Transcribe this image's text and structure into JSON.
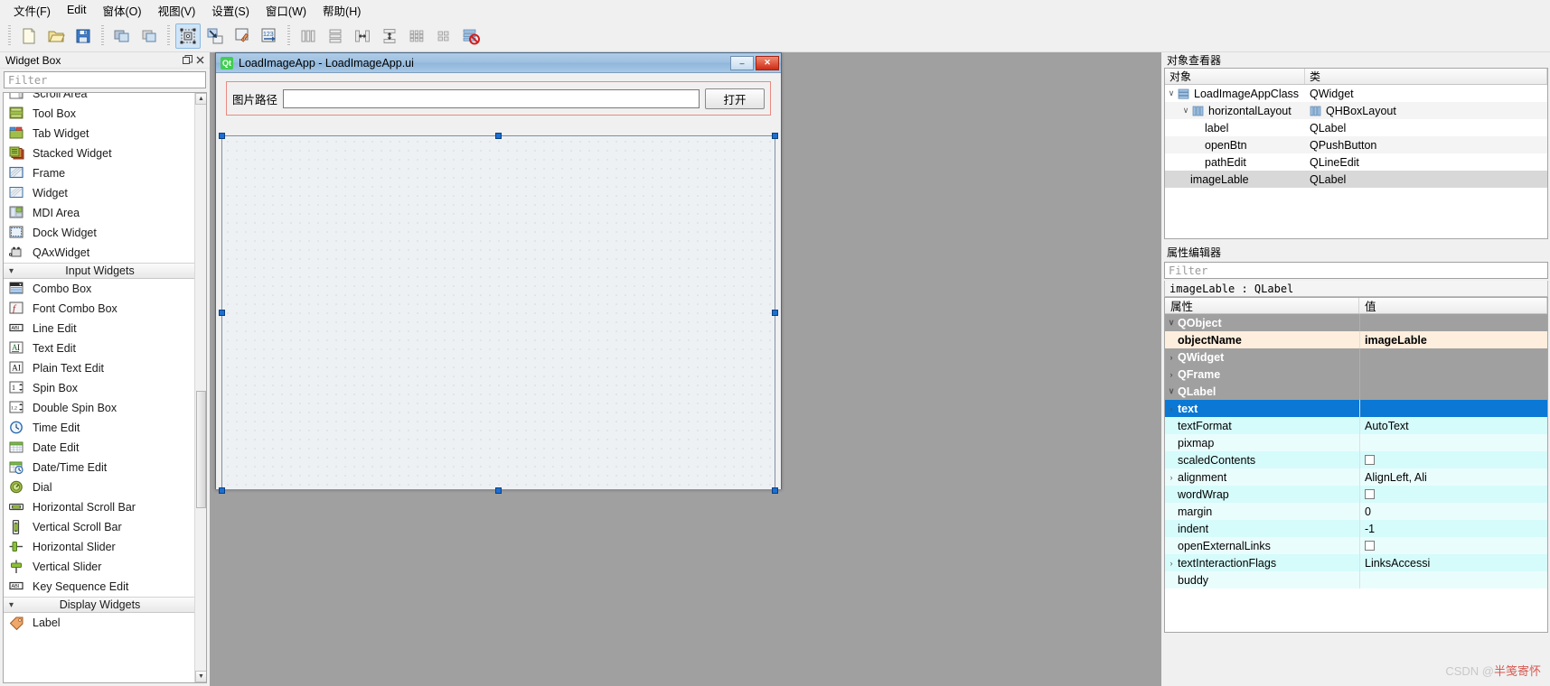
{
  "menu": {
    "items": [
      {
        "label": "文件(F)",
        "name": "menu-file"
      },
      {
        "label": "Edit",
        "name": "menu-edit"
      },
      {
        "label": "窗体(O)",
        "name": "menu-form"
      },
      {
        "label": "视图(V)",
        "name": "menu-view"
      },
      {
        "label": "设置(S)",
        "name": "menu-settings"
      },
      {
        "label": "窗口(W)",
        "name": "menu-window"
      },
      {
        "label": "帮助(H)",
        "name": "menu-help"
      }
    ]
  },
  "toolbar": {
    "groups": [
      [
        "new-icon",
        "open-icon",
        "save-icon"
      ],
      [
        "undo-icon",
        "redo-icon"
      ],
      [
        "edit-widgets-icon",
        "edit-signals-slots-icon",
        "edit-buddies-icon",
        "edit-tab-order-icon"
      ],
      [
        "layout-horizontally-icon",
        "layout-vertically-icon",
        "layout-horizontal-splitter-icon",
        "layout-vertical-splitter-icon",
        "layout-grid-icon",
        "layout-form-icon",
        "break-layout-icon"
      ]
    ]
  },
  "widget_box": {
    "title": "Widget Box",
    "filter_placeholder": "Filter",
    "partial_top_item": "Scroll Area",
    "items": [
      {
        "type": "item",
        "label": "Tool Box",
        "icon": "tool-box-icon"
      },
      {
        "type": "item",
        "label": "Tab Widget",
        "icon": "tab-widget-icon"
      },
      {
        "type": "item",
        "label": "Stacked Widget",
        "icon": "stacked-widget-icon"
      },
      {
        "type": "item",
        "label": "Frame",
        "icon": "frame-icon"
      },
      {
        "type": "item",
        "label": "Widget",
        "icon": "widget-icon"
      },
      {
        "type": "item",
        "label": "MDI Area",
        "icon": "mdi-area-icon"
      },
      {
        "type": "item",
        "label": "Dock Widget",
        "icon": "dock-widget-icon"
      },
      {
        "type": "item",
        "label": "QAxWidget",
        "icon": "qax-widget-icon"
      },
      {
        "type": "category",
        "label": "Input Widgets"
      },
      {
        "type": "item",
        "label": "Combo Box",
        "icon": "combo-box-icon"
      },
      {
        "type": "item",
        "label": "Font Combo Box",
        "icon": "font-combo-box-icon"
      },
      {
        "type": "item",
        "label": "Line Edit",
        "icon": "line-edit-icon"
      },
      {
        "type": "item",
        "label": "Text Edit",
        "icon": "text-edit-icon"
      },
      {
        "type": "item",
        "label": "Plain Text Edit",
        "icon": "plain-text-edit-icon"
      },
      {
        "type": "item",
        "label": "Spin Box",
        "icon": "spin-box-icon"
      },
      {
        "type": "item",
        "label": "Double Spin Box",
        "icon": "double-spin-box-icon"
      },
      {
        "type": "item",
        "label": "Time Edit",
        "icon": "time-edit-icon"
      },
      {
        "type": "item",
        "label": "Date Edit",
        "icon": "date-edit-icon"
      },
      {
        "type": "item",
        "label": "Date/Time Edit",
        "icon": "date-time-edit-icon"
      },
      {
        "type": "item",
        "label": "Dial",
        "icon": "dial-icon"
      },
      {
        "type": "item",
        "label": "Horizontal Scroll Bar",
        "icon": "horizontal-scroll-bar-icon"
      },
      {
        "type": "item",
        "label": "Vertical Scroll Bar",
        "icon": "vertical-scroll-bar-icon"
      },
      {
        "type": "item",
        "label": "Horizontal Slider",
        "icon": "horizontal-slider-icon"
      },
      {
        "type": "item",
        "label": "Vertical Slider",
        "icon": "vertical-slider-icon"
      },
      {
        "type": "item",
        "label": "Key Sequence Edit",
        "icon": "key-sequence-edit-icon"
      },
      {
        "type": "category",
        "label": "Display Widgets"
      },
      {
        "type": "item",
        "label": "Label",
        "icon": "label-icon"
      }
    ]
  },
  "form_window": {
    "title": "LoadImageApp - LoadImageApp.ui",
    "logo_text": "Qt",
    "minimize_label": "–",
    "maximize_label": "□",
    "close_label": "✕",
    "path_label": "图片路径",
    "path_value": "",
    "open_button": "打开"
  },
  "object_inspector": {
    "title": "对象查看器",
    "columns": [
      "对象",
      "类"
    ],
    "rows": [
      {
        "indent": 0,
        "expander": "∨",
        "icon": "widget-stack-icon",
        "name": "LoadImageAppClass",
        "class": "QWidget",
        "selected": false
      },
      {
        "indent": 1,
        "expander": "∨",
        "icon": "hlayout-icon",
        "name": "horizontalLayout",
        "class": "QHBoxLayout",
        "selected": false
      },
      {
        "indent": 2,
        "expander": "",
        "icon": "",
        "name": "label",
        "class": "QLabel",
        "selected": false
      },
      {
        "indent": 2,
        "expander": "",
        "icon": "",
        "name": "openBtn",
        "class": "QPushButton",
        "selected": false
      },
      {
        "indent": 2,
        "expander": "",
        "icon": "",
        "name": "pathEdit",
        "class": "QLineEdit",
        "selected": false
      },
      {
        "indent": 1,
        "expander": "",
        "icon": "",
        "name": "imageLable",
        "class": "QLabel",
        "selected": true
      }
    ]
  },
  "property_editor": {
    "title": "属性编辑器",
    "filter_placeholder": "Filter",
    "object_header": "imageLable : QLabel",
    "columns": [
      "属性",
      "值"
    ],
    "rows": [
      {
        "kind": "group",
        "expander": "∨",
        "name": "QObject",
        "value": ""
      },
      {
        "kind": "highlight",
        "expander": "",
        "name": "objectName",
        "value": "imageLable"
      },
      {
        "kind": "group",
        "expander": "›",
        "name": "QWidget",
        "value": ""
      },
      {
        "kind": "group",
        "expander": "›",
        "name": "QFrame",
        "value": ""
      },
      {
        "kind": "group",
        "expander": "∨",
        "name": "QLabel",
        "value": ""
      },
      {
        "kind": "selected",
        "expander": "›",
        "name": "text",
        "value": ""
      },
      {
        "kind": "cyan",
        "expander": "",
        "name": "textFormat",
        "value": "AutoText"
      },
      {
        "kind": "cyan2",
        "expander": "",
        "name": "pixmap",
        "value": ""
      },
      {
        "kind": "cyan",
        "expander": "",
        "name": "scaledContents",
        "value": "",
        "checkbox": true
      },
      {
        "kind": "cyan2",
        "expander": "›",
        "name": "alignment",
        "value": "AlignLeft, Ali"
      },
      {
        "kind": "cyan",
        "expander": "",
        "name": "wordWrap",
        "value": "",
        "checkbox": true
      },
      {
        "kind": "cyan2",
        "expander": "",
        "name": "margin",
        "value": "0"
      },
      {
        "kind": "cyan",
        "expander": "",
        "name": "indent",
        "value": "-1"
      },
      {
        "kind": "cyan2",
        "expander": "",
        "name": "openExternalLinks",
        "value": "",
        "checkbox": true
      },
      {
        "kind": "cyan",
        "expander": "›",
        "name": "textInteractionFlags",
        "value": "LinksAccessi"
      },
      {
        "kind": "cyan2",
        "expander": "",
        "name": "buddy",
        "value": ""
      }
    ]
  },
  "watermark": {
    "prefix": "CSDN @",
    "author": "半笺寄怀"
  },
  "colors": {
    "selection_blue": "#0a78d4",
    "layout_red": "#e98a82",
    "handle_blue": "#1d6fd0",
    "qt_green": "#41cd52",
    "property_cyan": "#d6fbfb",
    "group_gray": "#a0a0a0"
  }
}
